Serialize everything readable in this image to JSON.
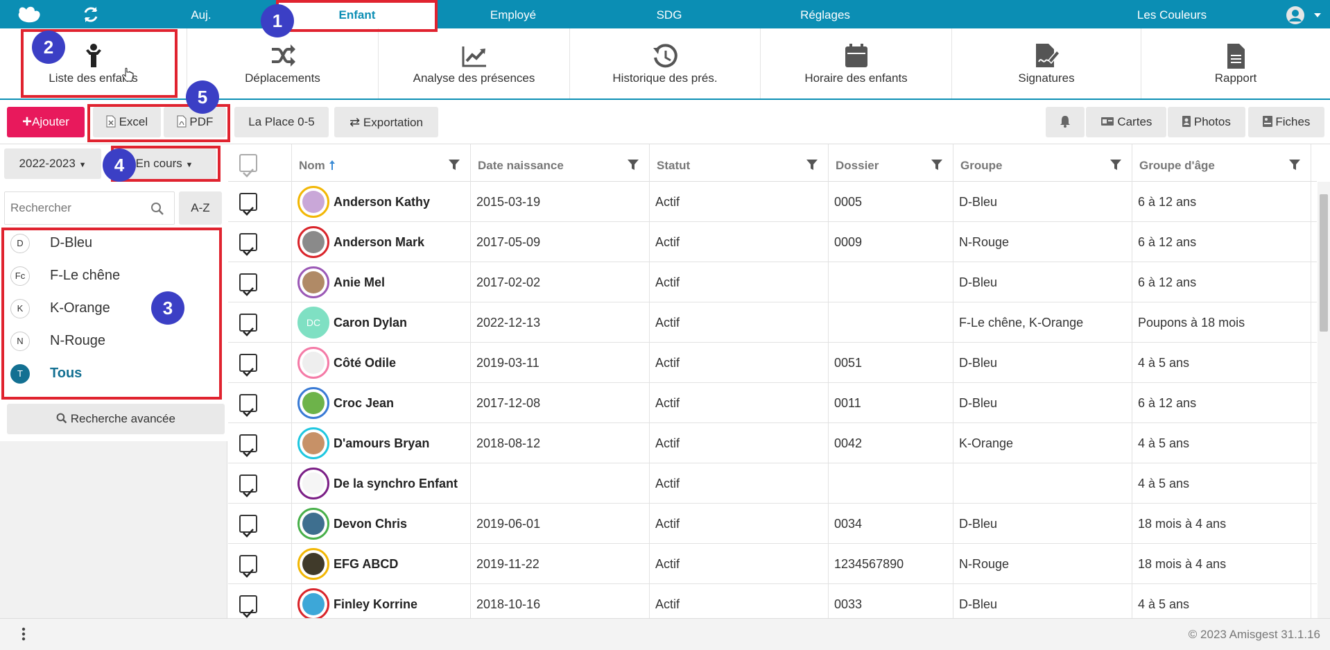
{
  "topnav": {
    "items": [
      {
        "label": "Auj.",
        "active": false
      },
      {
        "label": "Enfant",
        "active": true
      },
      {
        "label": "Employé",
        "active": false
      },
      {
        "label": "SDG",
        "active": false
      },
      {
        "label": "Réglages",
        "active": false
      }
    ],
    "org_name": "Les Couleurs"
  },
  "modules": [
    {
      "label": "Liste des enfants",
      "icon": "child-icon"
    },
    {
      "label": "Déplacements",
      "icon": "shuffle-icon"
    },
    {
      "label": "Analyse des présences",
      "icon": "trend-chart-icon"
    },
    {
      "label": "Historique des prés.",
      "icon": "history-icon"
    },
    {
      "label": "Horaire des enfants",
      "icon": "calendar-icon"
    },
    {
      "label": "Signatures",
      "icon": "signature-icon"
    },
    {
      "label": "Rapport",
      "icon": "document-icon"
    }
  ],
  "actions": {
    "add": "Ajouter",
    "excel": "Excel",
    "pdf": "PDF",
    "place": "La Place 0-5",
    "export": "Exportation",
    "cards": "Cartes",
    "photos": "Photos",
    "sheets": "Fiches"
  },
  "filters": {
    "year": "2022-2023",
    "status": "En cours",
    "search_placeholder": "Rechercher",
    "az": "A-Z",
    "advanced": "Recherche avancée"
  },
  "groups": [
    {
      "abbr": "D",
      "label": "D-Bleu",
      "selected": false
    },
    {
      "abbr": "Fc",
      "label": "F-Le chêne",
      "selected": false
    },
    {
      "abbr": "K",
      "label": "K-Orange",
      "selected": false
    },
    {
      "abbr": "N",
      "label": "N-Rouge",
      "selected": false
    },
    {
      "abbr": "T",
      "label": "Tous",
      "selected": true
    }
  ],
  "table": {
    "columns": [
      "Nom",
      "Date naissance",
      "Statut",
      "Dossier",
      "Groupe",
      "Groupe d'âge"
    ],
    "rows": [
      {
        "name": "Anderson Kathy",
        "birth": "2015-03-19",
        "status": "Actif",
        "file": "0005",
        "group": "D-Bleu",
        "age_group": "6 à 12 ans",
        "ring": "#f2b705",
        "fill": "#c9a7d8"
      },
      {
        "name": "Anderson Mark",
        "birth": "2017-05-09",
        "status": "Actif",
        "file": "0009",
        "group": "N-Rouge",
        "age_group": "6 à 12 ans",
        "ring": "#d9252b",
        "fill": "#8a8a8a"
      },
      {
        "name": "Anie Mel",
        "birth": "2017-02-02",
        "status": "Actif",
        "file": "",
        "group": "D-Bleu",
        "age_group": "6 à 12 ans",
        "ring": "#9b59b6",
        "fill": "#b08a66"
      },
      {
        "name": "Caron Dylan",
        "birth": "2022-12-13",
        "status": "Actif",
        "file": "",
        "group": "F-Le chêne, K-Orange",
        "age_group": "Poupons à 18 mois",
        "ring": "#7fe0c3",
        "fill": "#7fe0c3",
        "initials": "DC"
      },
      {
        "name": "Côté Odile",
        "birth": "2019-03-11",
        "status": "Actif",
        "file": "0051",
        "group": "D-Bleu",
        "age_group": "4 à 5 ans",
        "ring": "#f47aa6",
        "fill": "#eeeeee"
      },
      {
        "name": "Croc Jean",
        "birth": "2017-12-08",
        "status": "Actif",
        "file": "0011",
        "group": "D-Bleu",
        "age_group": "6 à 12 ans",
        "ring": "#3a7bd5",
        "fill": "#6db34a"
      },
      {
        "name": "D'amours Bryan",
        "birth": "2018-08-12",
        "status": "Actif",
        "file": "0042",
        "group": "K-Orange",
        "age_group": "4 à 5 ans",
        "ring": "#1fc7e0",
        "fill": "#c79167"
      },
      {
        "name": "De la synchro Enfant",
        "birth": "",
        "status": "Actif",
        "file": "",
        "group": "",
        "age_group": "4 à 5 ans",
        "ring": "#7b1f86",
        "fill": "#f5f5f5"
      },
      {
        "name": "Devon Chris",
        "birth": "2019-06-01",
        "status": "Actif",
        "file": "0034",
        "group": "D-Bleu",
        "age_group": "18 mois à 4 ans",
        "ring": "#48b04a",
        "fill": "#3e6f8f"
      },
      {
        "name": "EFG ABCD",
        "birth": "2019-11-22",
        "status": "Actif",
        "file": "1234567890",
        "group": "N-Rouge",
        "age_group": "18 mois à 4 ans",
        "ring": "#f2b705",
        "fill": "#403a2a"
      },
      {
        "name": "Finley Korrine",
        "birth": "2018-10-16",
        "status": "Actif",
        "file": "0033",
        "group": "D-Bleu",
        "age_group": "4 à 5 ans",
        "ring": "#d9252b",
        "fill": "#3da7d8"
      }
    ]
  },
  "footer": {
    "copyright": "© 2023 Amisgest 31.1.16"
  },
  "annotations": [
    "1",
    "2",
    "3",
    "4",
    "5"
  ],
  "colors": {
    "primary": "#0b8eb4",
    "add_button": "#e8195c",
    "highlight": "#e0232f",
    "badge": "#3b3fc5",
    "selected_group": "#137092"
  }
}
